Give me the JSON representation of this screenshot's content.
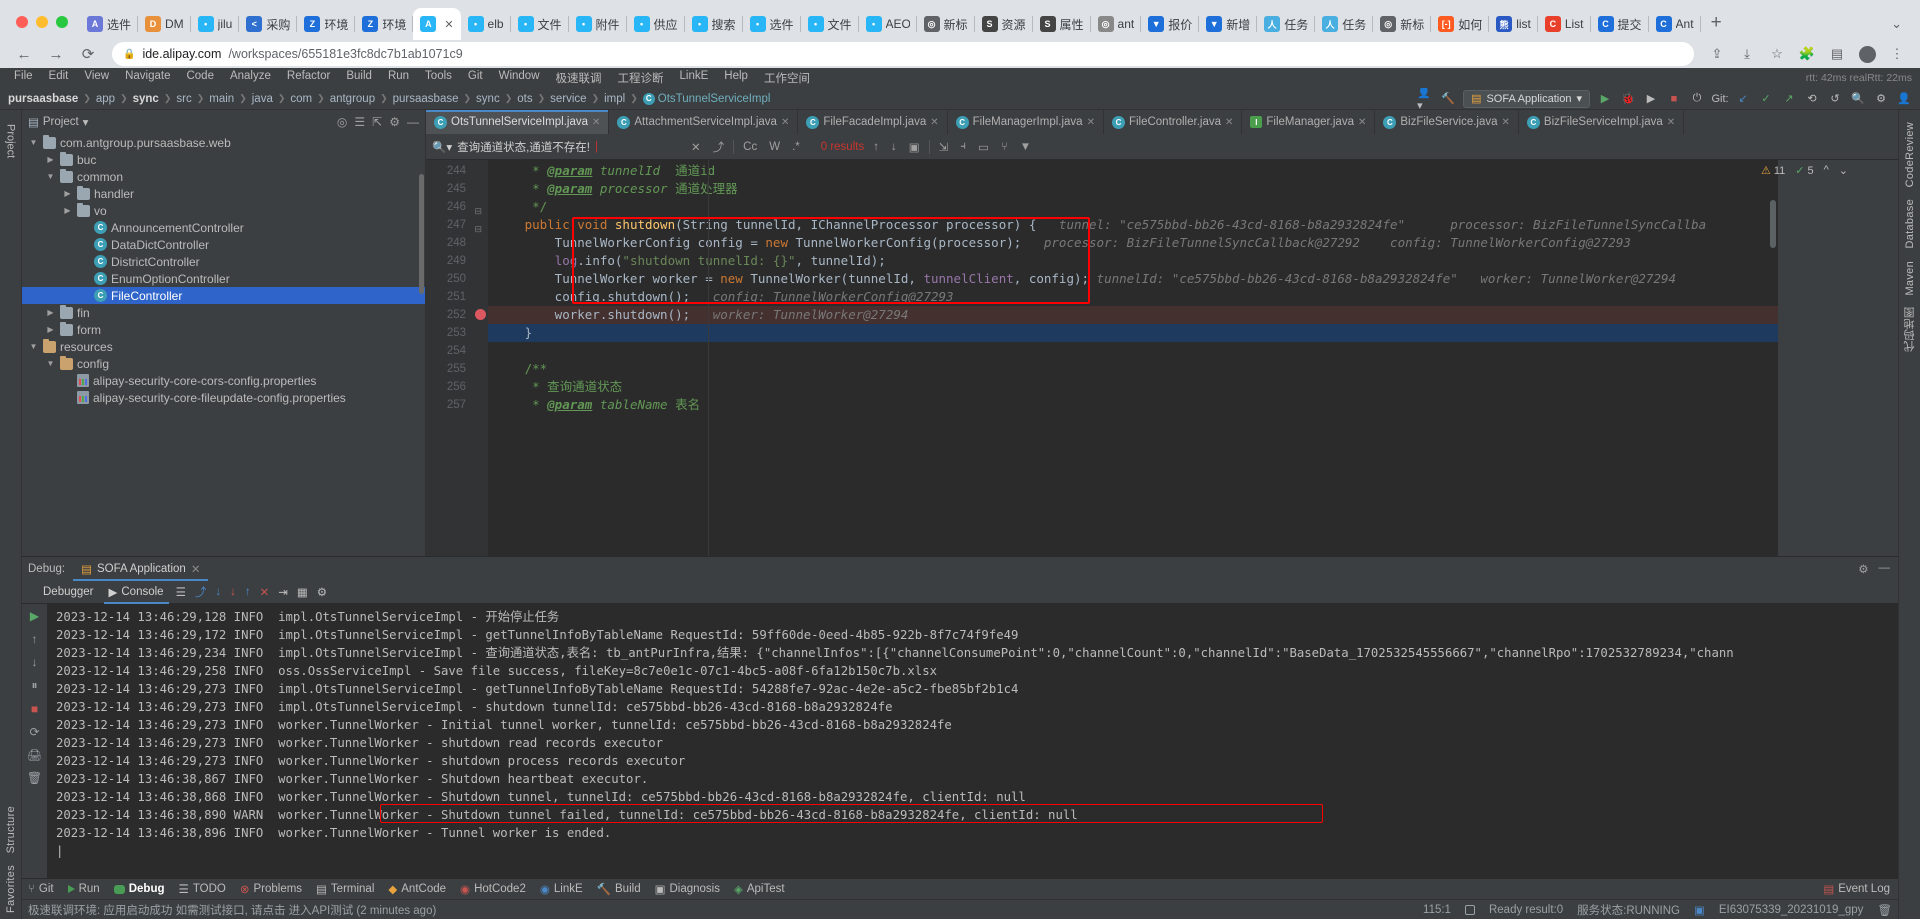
{
  "browser": {
    "tabs": [
      {
        "label": "选件",
        "icon": "A",
        "color": "#6b78d8"
      },
      {
        "label": "DM",
        "icon": "D",
        "color": "#e8913a"
      },
      {
        "label": "jilu",
        "icon": "•",
        "color": "#29b6f6"
      },
      {
        "label": "采购",
        "icon": "<",
        "color": "#2f6fd0"
      },
      {
        "label": "环境",
        "icon": "Z",
        "color": "#1e6fd9"
      },
      {
        "label": "环境",
        "icon": "Z",
        "color": "#1e6fd9"
      },
      {
        "label": "",
        "icon": "A",
        "color": "#29b6f6",
        "active": true
      },
      {
        "label": "elb",
        "icon": "•",
        "color": "#29b6f6"
      },
      {
        "label": "文件",
        "icon": "•",
        "color": "#29b6f6"
      },
      {
        "label": "附件",
        "icon": "•",
        "color": "#29b6f6"
      },
      {
        "label": "供应",
        "icon": "•",
        "color": "#29b6f6"
      },
      {
        "label": "搜索",
        "icon": "•",
        "color": "#29b6f6"
      },
      {
        "label": "选件",
        "icon": "•",
        "color": "#29b6f6"
      },
      {
        "label": "文件",
        "icon": "•",
        "color": "#29b6f6"
      },
      {
        "label": "AEO",
        "icon": "•",
        "color": "#29b6f6"
      },
      {
        "label": "新标",
        "icon": "◎",
        "color": "#5f6368"
      },
      {
        "label": "资源",
        "icon": "S",
        "color": "#444"
      },
      {
        "label": "属性",
        "icon": "S",
        "color": "#444"
      },
      {
        "label": "ant",
        "icon": "◎",
        "color": "#888"
      },
      {
        "label": "报价",
        "icon": "▼",
        "color": "#1e6fd9"
      },
      {
        "label": "新增",
        "icon": "▼",
        "color": "#1e6fd9"
      },
      {
        "label": "任务",
        "icon": "人",
        "color": "#49aee0"
      },
      {
        "label": "任务",
        "icon": "人",
        "color": "#49aee0"
      },
      {
        "label": "新标",
        "icon": "◎",
        "color": "#5f6368"
      },
      {
        "label": "如何",
        "icon": "[-]",
        "color": "#ff5a1f"
      },
      {
        "label": "list",
        "icon": "熊",
        "color": "#2b59c3"
      },
      {
        "label": "List",
        "icon": "C",
        "color": "#e8402a"
      },
      {
        "label": "提交",
        "icon": "C",
        "color": "#1e6fd9"
      },
      {
        "label": "Ant",
        "icon": "C",
        "color": "#1e6fd9"
      }
    ],
    "new_tab_label": "+",
    "url_host": "ide.alipay.com",
    "url_path": "/workspaces/655181e3fc8dc7b1ab1071c9"
  },
  "ide": {
    "menu": [
      "File",
      "Edit",
      "View",
      "Navigate",
      "Code",
      "Analyze",
      "Refactor",
      "Build",
      "Run",
      "Tools",
      "Git",
      "Window",
      "极速联调",
      "工程诊断",
      "LinkE",
      "Help",
      "工作空间"
    ],
    "rtt_status": "rtt: 42ms realRtt: 22ms",
    "breadcrumb": [
      "pursaasbase",
      "app",
      "sync",
      "src",
      "main",
      "java",
      "com",
      "antgroup",
      "pursaasbase",
      "sync",
      "ots",
      "service",
      "impl"
    ],
    "breadcrumb_class": "OtsTunnelServiceImpl",
    "run_config": "SOFA Application",
    "git_label": "Git:",
    "left_rail": [
      "Project",
      "Structure",
      "Favorites"
    ],
    "right_rail": [
      "CodeReview",
      "Database",
      "Maven",
      "代码地图"
    ],
    "project": {
      "title": "Project",
      "tree": [
        {
          "label": "com.antgroup.pursaasbase.web",
          "type": "folder",
          "indent": 0,
          "arrow": "v"
        },
        {
          "label": "buc",
          "type": "folder",
          "indent": 1,
          "arrow": ">"
        },
        {
          "label": "common",
          "type": "folder",
          "indent": 1,
          "arrow": "v"
        },
        {
          "label": "handler",
          "type": "folder",
          "indent": 2,
          "arrow": ">"
        },
        {
          "label": "vo",
          "type": "folder",
          "indent": 2,
          "arrow": ">"
        },
        {
          "label": "AnnouncementController",
          "type": "class",
          "indent": 3,
          "arrow": ""
        },
        {
          "label": "DataDictController",
          "type": "class",
          "indent": 3,
          "arrow": ""
        },
        {
          "label": "DistrictController",
          "type": "class",
          "indent": 3,
          "arrow": ""
        },
        {
          "label": "EnumOptionController",
          "type": "class",
          "indent": 3,
          "arrow": ""
        },
        {
          "label": "FileController",
          "type": "class",
          "indent": 3,
          "arrow": "",
          "selected": true
        },
        {
          "label": "fin",
          "type": "folder",
          "indent": 1,
          "arrow": ">"
        },
        {
          "label": "form",
          "type": "folder",
          "indent": 1,
          "arrow": ">"
        },
        {
          "label": "resources",
          "type": "res",
          "indent": 0,
          "arrow": "v"
        },
        {
          "label": "config",
          "type": "res",
          "indent": 1,
          "arrow": "v"
        },
        {
          "label": "alipay-security-core-cors-config.properties",
          "type": "prop",
          "indent": 2,
          "arrow": ""
        },
        {
          "label": "alipay-security-core-fileupdate-config.properties",
          "type": "prop",
          "indent": 2,
          "arrow": ""
        }
      ]
    },
    "editor_tabs": [
      {
        "label": "OtsTunnelServiceImpl.java",
        "kind": "C",
        "active": true
      },
      {
        "label": "AttachmentServiceImpl.java",
        "kind": "C"
      },
      {
        "label": "FileFacadeImpl.java",
        "kind": "C"
      },
      {
        "label": "FileManagerImpl.java",
        "kind": "C"
      },
      {
        "label": "FileController.java",
        "kind": "C"
      },
      {
        "label": "FileManager.java",
        "kind": "I"
      },
      {
        "label": "BizFileService.java",
        "kind": "C"
      },
      {
        "label": "BizFileServiceImpl.java",
        "kind": "C"
      }
    ],
    "find": {
      "query": "查询通道状态,通道不存在!",
      "results": "0 results",
      "match_case": "Cc",
      "words": "W",
      "regex": ".*"
    },
    "inspection": {
      "warnings": "11",
      "checks": "5"
    },
    "code_lines": [
      {
        "num": "244",
        "segs": [
          {
            "t": "    * ",
            "c": "doc"
          },
          {
            "t": "@param",
            "c": "anno-u"
          },
          {
            "t": " tunnelId  ",
            "c": "doc-i"
          },
          {
            "t": "通道id",
            "c": "doc"
          }
        ]
      },
      {
        "num": "245",
        "segs": [
          {
            "t": "    * ",
            "c": "doc"
          },
          {
            "t": "@param",
            "c": "anno-u"
          },
          {
            "t": " processor ",
            "c": "doc-i"
          },
          {
            "t": "通道处理器",
            "c": "doc"
          }
        ]
      },
      {
        "num": "246",
        "segs": [
          {
            "t": "    */",
            "c": "doc"
          }
        ],
        "fold": "-"
      },
      {
        "num": "247",
        "segs": [
          {
            "t": "   ",
            "c": "id"
          },
          {
            "t": "public void ",
            "c": "kw"
          },
          {
            "t": "shutdown",
            "c": "mth"
          },
          {
            "t": "(String tunnelId, IChannelProcessor processor) {",
            "c": "id"
          },
          {
            "t": "   tunnel: \"ce575bbd-bb26-43cd-8168-b8a2932824fe\"      processor: BizFileTunnelSyncCallba",
            "c": "hint"
          }
        ],
        "fold": "-"
      },
      {
        "num": "248",
        "segs": [
          {
            "t": "       TunnelWorkerConfig config = ",
            "c": "id"
          },
          {
            "t": "new ",
            "c": "kw"
          },
          {
            "t": "TunnelWorkerConfig(processor);",
            "c": "id"
          },
          {
            "t": "   processor: BizFileTunnelSyncCallback@27292    config: TunnelWorkerConfig@27293",
            "c": "hint"
          }
        ]
      },
      {
        "num": "249",
        "segs": [
          {
            "t": "       ",
            "c": "id"
          },
          {
            "t": "log",
            "c": "fld"
          },
          {
            "t": ".info(",
            "c": "id"
          },
          {
            "t": "\"shutdown tunnelId: {}\"",
            "c": "str"
          },
          {
            "t": ", tunnelId);",
            "c": "id"
          }
        ]
      },
      {
        "num": "250",
        "segs": [
          {
            "t": "       TunnelWorker worker = ",
            "c": "id"
          },
          {
            "t": "new ",
            "c": "kw"
          },
          {
            "t": "TunnelWorker(tunnelId, ",
            "c": "id"
          },
          {
            "t": "tunnelClient",
            "c": "fld"
          },
          {
            "t": ", config);",
            "c": "id"
          },
          {
            "t": " tunnelId: \"ce575bbd-bb26-43cd-8168-b8a2932824fe\"   worker: TunnelWorker@27294",
            "c": "hint"
          }
        ]
      },
      {
        "num": "251",
        "segs": [
          {
            "t": "       config.shutdown();",
            "c": "id"
          },
          {
            "t": "   config: TunnelWorkerConfig@27293",
            "c": "hint"
          }
        ]
      },
      {
        "num": "252",
        "segs": [
          {
            "t": "       worker.shutdown();",
            "c": "id"
          },
          {
            "t": "   worker: TunnelWorker@27294",
            "c": "hint"
          }
        ],
        "breakpoint": true
      },
      {
        "num": "253",
        "segs": [
          {
            "t": "   }",
            "c": "id"
          }
        ],
        "current": true
      },
      {
        "num": "254",
        "segs": [
          {
            "t": "",
            "c": "id"
          }
        ]
      },
      {
        "num": "255",
        "segs": [
          {
            "t": "   /**",
            "c": "doc"
          }
        ]
      },
      {
        "num": "256",
        "segs": [
          {
            "t": "    * ",
            "c": "doc"
          },
          {
            "t": "查询通道状态",
            "c": "doc"
          }
        ]
      },
      {
        "num": "257",
        "segs": [
          {
            "t": "    * ",
            "c": "doc"
          },
          {
            "t": "@param",
            "c": "anno-u"
          },
          {
            "t": " tableName ",
            "c": "doc-i"
          },
          {
            "t": "表名",
            "c": "doc"
          }
        ]
      }
    ],
    "debug": {
      "label": "Debug:",
      "session_tab": "SOFA Application",
      "tabs": [
        {
          "label": "Debugger"
        },
        {
          "label": "Console",
          "active": true
        }
      ],
      "console_lines": [
        {
          "text": "2023-12-14 13:46:29,128 INFO  impl.OtsTunnelServiceImpl - 开始停止任务"
        },
        {
          "text": "2023-12-14 13:46:29,172 INFO  impl.OtsTunnelServiceImpl - getTunnelInfoByTableName RequestId: 59ff60de-0eed-4b85-922b-8f7c74f9fe49"
        },
        {
          "text": "2023-12-14 13:46:29,234 INFO  impl.OtsTunnelServiceImpl - 查询通道状态,表名: tb_antPurInfra,结果: {\"channelInfos\":[{\"channelConsumePoint\":0,\"channelCount\":0,\"channelId\":\"BaseData_1702532545556667\",\"channelRpo\":1702532789234,\"chann"
        },
        {
          "text": "2023-12-14 13:46:29,258 INFO  oss.OssServiceImpl - Save file success, fileKey=8c7e0e1c-07c1-4bc5-a08f-6fa12b150c7b.xlsx"
        },
        {
          "text": "2023-12-14 13:46:29,273 INFO  impl.OtsTunnelServiceImpl - getTunnelInfoByTableName RequestId: 54288fe7-92ac-4e2e-a5c2-fbe85bf2b1c4"
        },
        {
          "text": "2023-12-14 13:46:29,273 INFO  impl.OtsTunnelServiceImpl - shutdown tunnelId: ce575bbd-bb26-43cd-8168-b8a2932824fe"
        },
        {
          "text": "2023-12-14 13:46:29,273 INFO  worker.TunnelWorker - Initial tunnel worker, tunnelId: ce575bbd-bb26-43cd-8168-b8a2932824fe"
        },
        {
          "text": "2023-12-14 13:46:29,273 INFO  worker.TunnelWorker - shutdown read records executor"
        },
        {
          "text": "2023-12-14 13:46:29,273 INFO  worker.TunnelWorker - shutdown process records executor"
        },
        {
          "text": "2023-12-14 13:46:38,867 INFO  worker.TunnelWorker - Shutdown heartbeat executor."
        },
        {
          "text": "2023-12-14 13:46:38,868 INFO  worker.TunnelWorker - Shutdown tunnel, tunnelId: ce575bbd-bb26-43cd-8168-b8a2932824fe, clientId: null"
        },
        {
          "text": "2023-12-14 13:46:38,890 WARN  worker.TunnelWorker - Shutdown tunnel failed, tunnelId: ce575bbd-bb26-43cd-8168-b8a2932824fe, clientId: null",
          "highlight": true
        },
        {
          "text": "2023-12-14 13:46:38,896 INFO  worker.TunnelWorker - Tunnel worker is ended."
        }
      ]
    },
    "status_bar": [
      {
        "label": "Git",
        "icon": "git-icon"
      },
      {
        "label": "Run",
        "icon": "run-icon"
      },
      {
        "label": "Debug",
        "icon": "debug-icon",
        "active": true
      },
      {
        "label": "TODO",
        "icon": "todo-icon"
      },
      {
        "label": "Problems",
        "icon": "problems-icon"
      },
      {
        "label": "Terminal",
        "icon": "terminal-icon"
      },
      {
        "label": "AntCode",
        "icon": "antcode-icon"
      },
      {
        "label": "HotCode2",
        "icon": "hotcode-icon"
      },
      {
        "label": "LinkE",
        "icon": "linke-icon"
      },
      {
        "label": "Build",
        "icon": "build-icon"
      },
      {
        "label": "Diagnosis",
        "icon": "diagnosis-icon"
      },
      {
        "label": "ApiTest",
        "icon": "apitest-icon"
      }
    ],
    "event_log": "Event Log",
    "footer": {
      "message": "极速联调环境: 应用启动成功 如需测试接口, 请点击 进入API测试 (2 minutes ago)",
      "caret": "115:1",
      "ready": "Ready result:0",
      "service_status": "服务状态:RUNNING",
      "build_id": "EI63075339_20231019_gpy"
    }
  }
}
